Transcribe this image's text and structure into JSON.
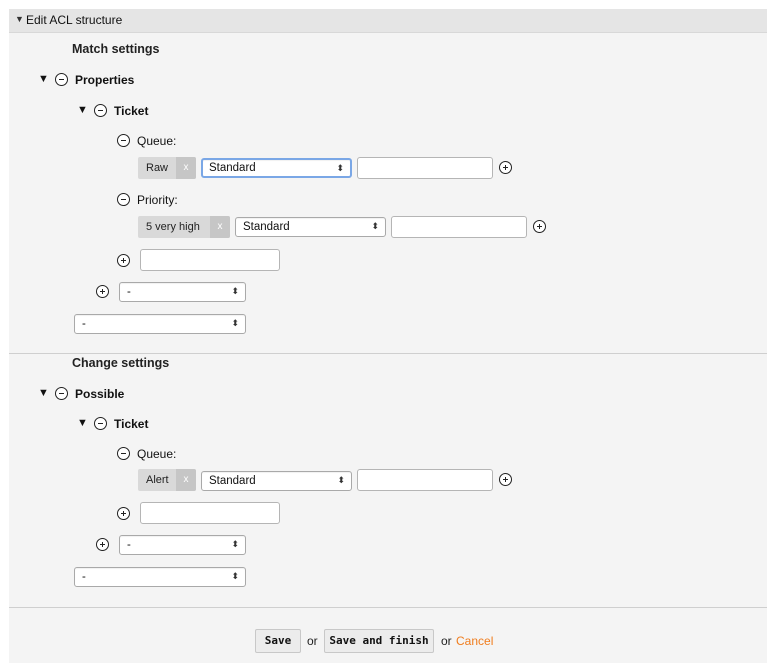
{
  "header": {
    "title": "Edit ACL structure"
  },
  "match": {
    "title": "Match settings",
    "group_label": "Properties",
    "sub_label": "Ticket",
    "fields": [
      {
        "label": "Queue:",
        "tag": "Raw",
        "tag_close": "x",
        "operator": "Standard",
        "value": ""
      },
      {
        "label": "Priority:",
        "tag": "5 very high",
        "tag_close": "x",
        "operator": "Standard",
        "value": ""
      }
    ],
    "new_field_value": "",
    "sub_select": "-",
    "group_select": "-"
  },
  "change": {
    "title": "Change settings",
    "group_label": "Possible",
    "sub_label": "Ticket",
    "fields": [
      {
        "label": "Queue:",
        "tag": "Alert",
        "tag_close": "x",
        "operator": "Standard",
        "value": ""
      }
    ],
    "new_field_value": "",
    "sub_select": "-",
    "group_select": "-"
  },
  "footer": {
    "save_label": "Save",
    "or1": "or",
    "save_finish_label": "Save and finish",
    "or2": "or",
    "cancel_label": "Cancel"
  },
  "icons": {
    "expand": "triangle-down-icon",
    "remove": "circle-minus-icon",
    "add": "circle-plus-icon"
  },
  "colors": {
    "cancel_link": "#f07d1e",
    "focus_border": "#7aa7e6",
    "panel_bg": "#f4f4f4"
  }
}
